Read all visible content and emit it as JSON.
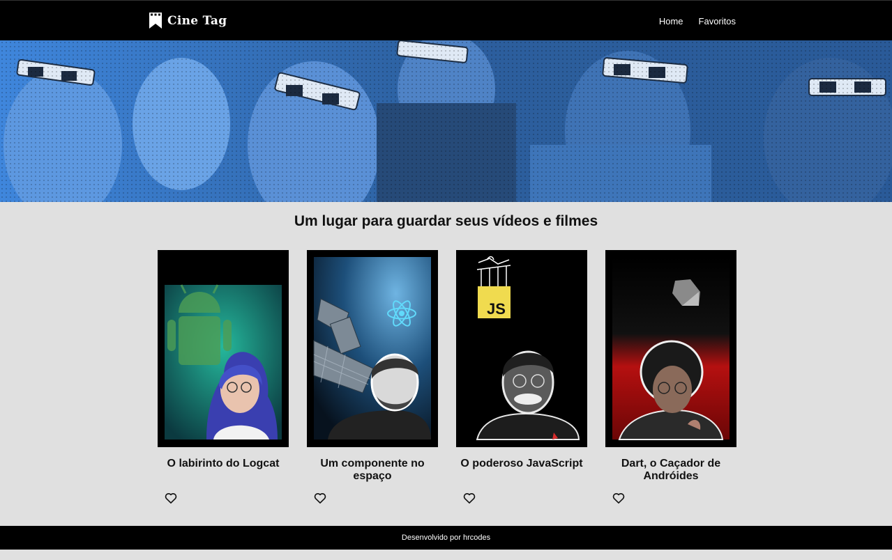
{
  "header": {
    "logo_text": "Cine Tag",
    "nav": [
      {
        "label": "Home"
      },
      {
        "label": "Favoritos"
      }
    ]
  },
  "main": {
    "tagline": "Um lugar para guardar seus vídeos e filmes",
    "cards": [
      {
        "title": "O labirinto do Logcat",
        "theme": "android",
        "accent": "#1fa38a"
      },
      {
        "title": "Um componente no espaço",
        "theme": "react",
        "accent": "#1b4f7a"
      },
      {
        "title": "O poderoso JavaScript",
        "theme": "javascript",
        "accent": "#f0db4f"
      },
      {
        "title": "Dart, o Caçador de Andróides",
        "theme": "dart",
        "accent": "#c81414"
      }
    ]
  },
  "footer": {
    "text": "Desenvolvido por hrcodes"
  },
  "colors": {
    "header_bg": "#000000",
    "banner_tint": "#3a7bd5",
    "page_bg": "#e0e0e0"
  },
  "icons": {
    "logo": "bookmark-film-icon",
    "favorite": "heart-outline-icon"
  }
}
